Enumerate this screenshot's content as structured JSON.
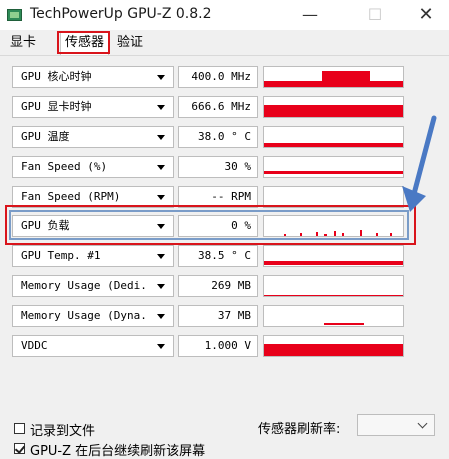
{
  "window": {
    "title": "TechPowerUp GPU-Z 0.8.2",
    "minimize": "—",
    "maximize": "☐",
    "close": "✕"
  },
  "tabs": [
    {
      "label": "显卡"
    },
    {
      "label": "传感器"
    },
    {
      "label": "验证"
    }
  ],
  "sensors": [
    {
      "label": "GPU 核心时钟",
      "value": "400.0 MHz"
    },
    {
      "label": "GPU 显卡时钟",
      "value": "666.6 MHz"
    },
    {
      "label": "GPU 温度",
      "value": "38.0 ° C"
    },
    {
      "label": "Fan Speed (%)",
      "value": "30 %"
    },
    {
      "label": "Fan Speed (RPM)",
      "value": "-- RPM"
    },
    {
      "label": "GPU 负载",
      "value": "0 %"
    },
    {
      "label": "GPU Temp. #1",
      "value": "38.5 ° C"
    },
    {
      "label": "Memory Usage (Dedi.",
      "value": "269 MB"
    },
    {
      "label": "Memory Usage (Dyna.",
      "value": "37 MB"
    },
    {
      "label": "VDDC",
      "value": "1.000 V"
    }
  ],
  "footer": {
    "log_to_file": "记录到文件",
    "continue_background": "GPU-Z 在后台继续刷新该屏幕",
    "refresh_rate_label": "传感器刷新率:",
    "refresh_rate_value": ""
  },
  "colors": {
    "graph": "#e8001a",
    "highlight": "#d9141b",
    "arrow": "#4a79c4"
  }
}
